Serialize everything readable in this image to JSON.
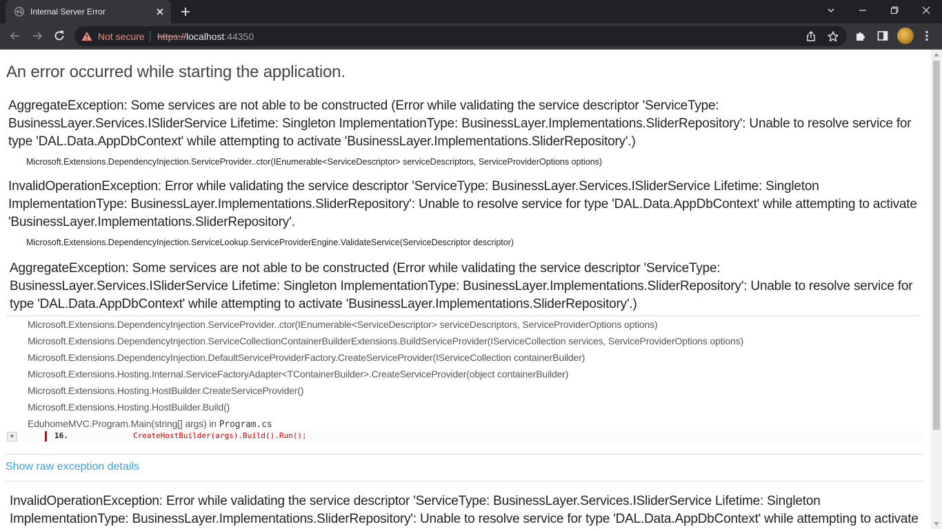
{
  "browser": {
    "tab_title": "Internal Server Error",
    "security_label": "Not secure",
    "url_scheme": "https://",
    "url_host": "localhost",
    "url_port": ":44350"
  },
  "page": {
    "title": "An error occurred while starting the application.",
    "exceptions": [
      {
        "message": "AggregateException: Some services are not able to be constructed (Error while validating the service descriptor 'ServiceType: BusinessLayer.Services.ISliderService Lifetime: Singleton ImplementationType: BusinessLayer.Implementations.SliderRepository': Unable to resolve service for type 'DAL.Data.AppDbContext' while attempting to activate 'BusinessLayer.Implementations.SliderRepository'.)",
        "frame": "Microsoft.Extensions.DependencyInjection.ServiceProvider..ctor(IEnumerable<ServiceDescriptor> serviceDescriptors, ServiceProviderOptions options)"
      },
      {
        "message": "InvalidOperationException: Error while validating the service descriptor 'ServiceType: BusinessLayer.Services.ISliderService Lifetime: Singleton ImplementationType: BusinessLayer.Implementations.SliderRepository': Unable to resolve service for type 'DAL.Data.AppDbContext' while attempting to activate 'BusinessLayer.Implementations.SliderRepository'.",
        "frame": "Microsoft.Extensions.DependencyInjection.ServiceLookup.ServiceProviderEngine.ValidateService(ServiceDescriptor descriptor)"
      }
    ],
    "detail": {
      "message": "AggregateException: Some services are not able to be constructed (Error while validating the service descriptor 'ServiceType: BusinessLayer.Services.ISliderService Lifetime: Singleton ImplementationType: BusinessLayer.Implementations.SliderRepository': Unable to resolve service for type 'DAL.Data.AppDbContext' while attempting to activate 'BusinessLayer.Implementations.SliderRepository'.)",
      "stack": [
        "Microsoft.Extensions.DependencyInjection.ServiceProvider..ctor(IEnumerable<ServiceDescriptor> serviceDescriptors, ServiceProviderOptions options)",
        "Microsoft.Extensions.DependencyInjection.ServiceCollectionContainerBuilderExtensions.BuildServiceProvider(IServiceCollection services, ServiceProviderOptions options)",
        "Microsoft.Extensions.DependencyInjection.DefaultServiceProviderFactory.CreateServiceProvider(IServiceCollection containerBuilder)",
        "Microsoft.Extensions.Hosting.Internal.ServiceFactoryAdapter<TContainerBuilder>.CreateServiceProvider(object containerBuilder)",
        "Microsoft.Extensions.Hosting.HostBuilder.CreateServiceProvider()",
        "Microsoft.Extensions.Hosting.HostBuilder.Build()"
      ],
      "last_frame_text": "EduhomeMVC.Program.Main(string[] args) in ",
      "last_frame_file": "Program.cs",
      "code_expander": "+",
      "code_line_number": "16.",
      "code_line": "CreateHostBuilder(args).Build().Run();"
    },
    "raw_link": "Show raw exception details",
    "next_message": "InvalidOperationException: Error while validating the service descriptor 'ServiceType: BusinessLayer.Services.ISliderService Lifetime: Singleton ImplementationType: BusinessLayer.Implementations.SliderRepository': Unable to resolve service for type 'DAL.Data.AppDbContext' while attempting to activate 'BusinessLayer.Implementations.SliderRepository'."
  },
  "colors": {
    "link": "#3ea0d6",
    "code_error": "#cc0000",
    "not_secure": "#f28b82"
  }
}
